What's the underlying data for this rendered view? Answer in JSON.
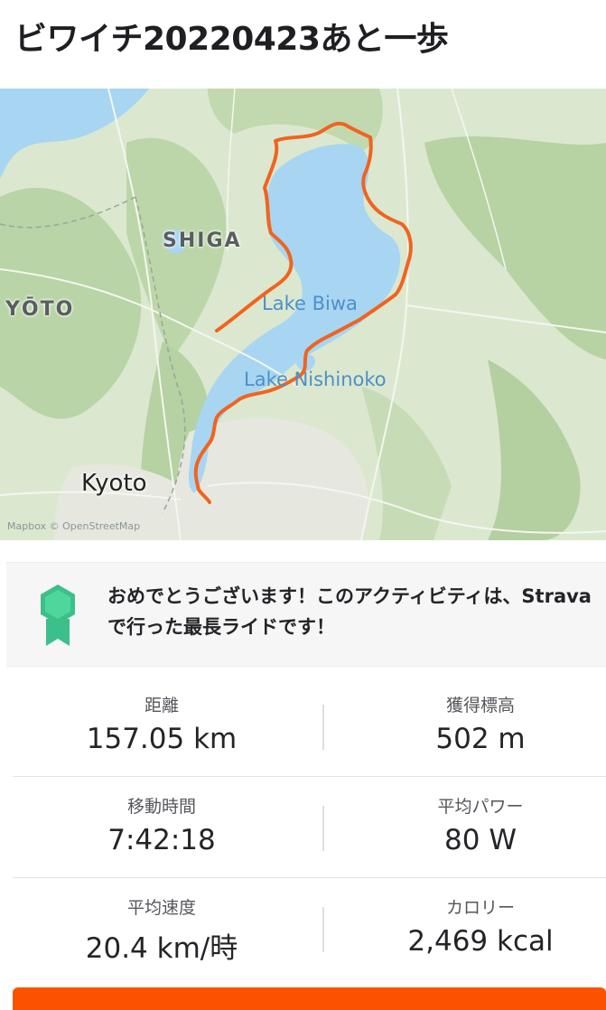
{
  "header": {
    "title": "ビワイチ20220423あと一歩"
  },
  "map": {
    "labels": {
      "shiga": "SHIGA",
      "kyoto_region": "YŌTO",
      "lake_biwa": "Lake Biwa",
      "lake_nishinoko": "Lake Nishinoko",
      "kyoto_city": "Kyoto"
    },
    "attribution": "Mapbox © OpenStreetMap",
    "route_color": "#f0641f",
    "water_color": "#a8d5f2"
  },
  "achievement": {
    "icon": "achievement-medal-icon",
    "text": "おめでとうございます！このアクティビティは、Stravaで行った最長ライドです！"
  },
  "stats": {
    "distance": {
      "label": "距離",
      "value": "157.05 km"
    },
    "elevation": {
      "label": "獲得標高",
      "value": "502 m"
    },
    "moving_time": {
      "label": "移動時間",
      "value": "7:42:18"
    },
    "avg_power": {
      "label": "平均パワー",
      "value": "80 W"
    },
    "avg_speed": {
      "label": "平均速度",
      "value": "20.4 km/時"
    },
    "calories": {
      "label": "カロリー",
      "value": "2,469 kcal"
    }
  },
  "colors": {
    "brand": "#fc5200",
    "badge": "#3dbf8a"
  }
}
